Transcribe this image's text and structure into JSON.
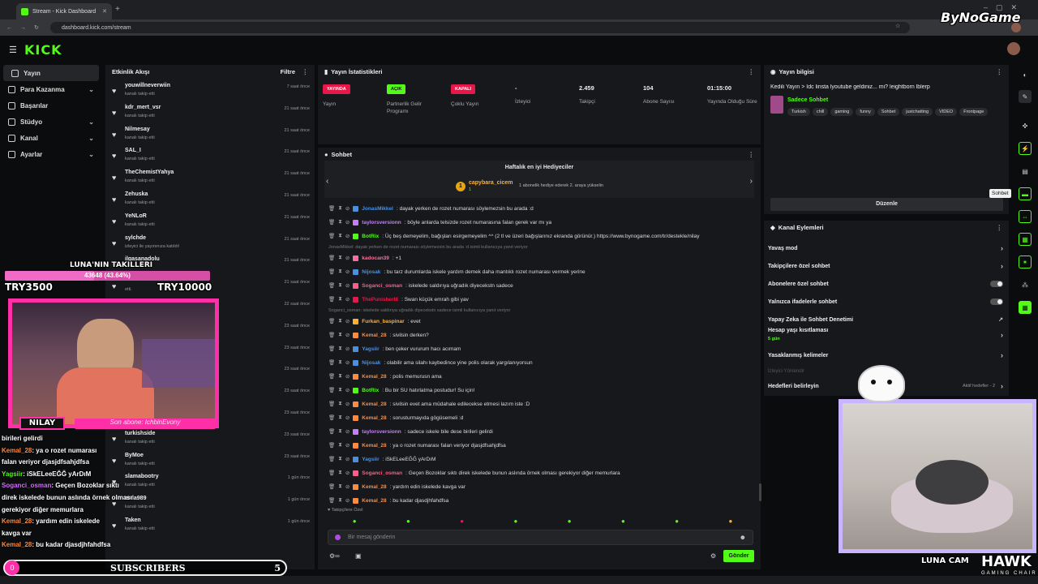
{
  "browser": {
    "tab_title": "Stream - Kick Dashboard",
    "url": "dashboard.kick.com/stream",
    "watermark": "ByNoGame"
  },
  "kick": {
    "logo": "KICK"
  },
  "sidebar": {
    "items": [
      {
        "label": "Yayın",
        "icon": "broadcast-icon"
      },
      {
        "label": "Para Kazanma",
        "icon": "money-icon"
      },
      {
        "label": "Başarılar",
        "icon": "trophy-icon"
      },
      {
        "label": "Stüdyo",
        "icon": "studio-icon"
      },
      {
        "label": "Kanal",
        "icon": "channel-icon"
      },
      {
        "label": "Ayarlar",
        "icon": "gear-icon"
      }
    ]
  },
  "activity": {
    "title": "Etkinlik Akışı",
    "filter": "Filtre",
    "items": [
      {
        "name": "youwillneverwiin",
        "sub": "kanalı takip etti",
        "time": "7 saat önce"
      },
      {
        "name": "kdr_mert_vsr",
        "sub": "kanalı takip etti",
        "time": "21 saat önce"
      },
      {
        "name": "Nilmesay",
        "sub": "kanalı takip etti",
        "time": "21 saat önce"
      },
      {
        "name": "SAL_I",
        "sub": "kanalı takip etti",
        "time": "21 saat önce"
      },
      {
        "name": "TheChemistYahya",
        "sub": "kanalı takip etti",
        "time": "21 saat önce"
      },
      {
        "name": "Zehuska",
        "sub": "kanalı takip etti",
        "time": "21 saat önce"
      },
      {
        "name": "YeNLoR",
        "sub": "kanalı takip etti",
        "time": "21 saat önce"
      },
      {
        "name": "sylchde",
        "sub": "izleyici ile yayınınıza katıldı!",
        "time": "21 saat önce"
      },
      {
        "name": "ilgasanadolu",
        "sub": "",
        "time": "21 saat önce"
      },
      {
        "name": "",
        "sub": "etti.",
        "time": "21 saat önce"
      },
      {
        "name": "",
        "sub": "",
        "time": "22 saat önce"
      },
      {
        "name": "",
        "sub": "",
        "time": "23 saat önce"
      },
      {
        "name": "",
        "sub": "",
        "time": "23 saat önce"
      },
      {
        "name": "",
        "sub": "",
        "time": "23 saat önce"
      },
      {
        "name": "",
        "sub": "",
        "time": "23 saat önce"
      },
      {
        "name": "selmansama",
        "sub": "kanalı takip etti",
        "time": "23 saat önce"
      },
      {
        "name": "turkishside",
        "sub": "kanalı takip etti",
        "time": "23 saat önce"
      },
      {
        "name": "ByMoe",
        "sub": "kanalı takip etti",
        "time": "23 saat önce"
      },
      {
        "name": "slamabootry",
        "sub": "kanalı takip etti",
        "time": "1 gün önce"
      },
      {
        "name": "arda989",
        "sub": "kanalı takip etti",
        "time": "1 gün önce"
      },
      {
        "name": "Taken",
        "sub": "kanalı takip etti",
        "time": "1 gün önce"
      }
    ]
  },
  "stats": {
    "title": "Yayın İstatistikleri",
    "items": [
      {
        "badge": "YAYINDA",
        "label": "Yayın",
        "color": "#e8174a"
      },
      {
        "badge": "AÇIK",
        "label": "Partnerlik Gelir Programı",
        "color": "#53fc18"
      },
      {
        "badge": "KAPALI",
        "label": "Çoklu Yayın",
        "color": "#e8174a"
      },
      {
        "value": "-",
        "label": "İzleyici"
      },
      {
        "value": "2.459",
        "label": "Takipçi"
      },
      {
        "value": "104",
        "label": "Abone Sayısı"
      },
      {
        "value": "01:15:00",
        "label": "Yayında Olduğu Süre"
      }
    ]
  },
  "stream_info": {
    "title": "Yayın bilgisi",
    "stream_title": "Kedili Yayın > Idc linsta lyoutube geldiniz... mi? leightborn lblerp",
    "category": "Sadece Sohbet",
    "tags": [
      "Turkish",
      "chill",
      "gaming",
      "funny",
      "Sohbet",
      "justchatting",
      "VIDEO",
      "Frontpage"
    ],
    "edit_label": "Düzenle",
    "tooltip": "Sohbet"
  },
  "chat": {
    "title": "Sohbet",
    "gifters_title": "Haftalık en iyi Hediyeciler",
    "top_gifter": "capybara_cicem",
    "top_gifter_count": "1",
    "gifter_note": "1 abonelik hediye ederek 2. araya yükselin",
    "followers_only": "Takipçilere Özel",
    "input_placeholder": "Bir mesaj gönderin",
    "send_label": "Gönder",
    "messages": [
      {
        "user": "JonasMikkel",
        "text": ": dayak yerken de rozet numarası söylemezsin bu arada :d",
        "color": "#4a90e2"
      },
      {
        "user": "taylorsversionn",
        "text": ": böyle anlarda telsizde rozet numarasına falan gerek var mı ya",
        "color": "#c77dff"
      },
      {
        "user": "BotRix",
        "text": ": Üç beş demeyelim, bağışları esirgemeyelim ^^ (2 tl ve üzeri bağışlarınız ekranda görünür.) https://www.bynogame.com/tr/destekle/nilay",
        "color": "#53fc18"
      },
      {
        "reply": "JonasMikkel: dayak yerken de rozet numarası söylemezsin bu arada :d isimli kullanıcıya yanıt veriyor"
      },
      {
        "user": "kadocan39",
        "text": ": +1",
        "color": "#ff6b9a"
      },
      {
        "user": "Nijosak",
        "text": ": bu tarz durumlarda iskele yardım demek daha mantıklı rozet numarası vermek yerine",
        "color": "#4a90e2"
      },
      {
        "user": "Soganci_osman",
        "text": ": iskelede saldırıya uğradık diyecekstn sadece",
        "color": "#ff5c8a"
      },
      {
        "user": "ThePunisherIII",
        "text": ": Swan küçük emrah gibi yav",
        "color": "#e8174a"
      },
      {
        "reply": "Soganci_osman: iskelede saldırıya uğradık diyecekstn sadece isimli kullanıcıya yanıt veriyor"
      },
      {
        "user": "Furkan_baspinar",
        "text": ": evet",
        "color": "#ffb02e"
      },
      {
        "user": "Kemal_28",
        "text": ": sivilsin derken?",
        "color": "#ff8a3d"
      },
      {
        "user": "Yagsiir",
        "text": ": ben çeker vururum hacı acımam",
        "color": "#4a90e2"
      },
      {
        "user": "Nijosak",
        "text": ": olabilir ama silahı kaybedince yine polis olarak yargılanıyorsun",
        "color": "#4a90e2"
      },
      {
        "user": "Kemal_28",
        "text": ": polis memurusn ama",
        "color": "#ff8a3d"
      },
      {
        "user": "BotRix",
        "text": ": Bu bir SU hatırlatma postudur! Su için!",
        "color": "#53fc18"
      },
      {
        "user": "Kemal_28",
        "text": ": sivilsin evet ama müdahale edilecekse etmesi lazım iste :D",
        "color": "#ff8a3d"
      },
      {
        "user": "Kemal_28",
        "text": ": sorusturmayıda gögüsemeli :d",
        "color": "#ff8a3d"
      },
      {
        "user": "taylorsversionn",
        "text": ": sadece iskele bile dese birileri gelirdi",
        "color": "#c77dff"
      },
      {
        "user": "Kemal_28",
        "text": ": ya o rozet numarası falan veriyor djasjdfsahjdfsa",
        "color": "#ff8a3d"
      },
      {
        "user": "Yagsiir",
        "text": ": iSkELeeEĞĞ yArDıM",
        "color": "#4a90e2"
      },
      {
        "user": "Soganci_osman",
        "text": ": Geçen Bozoklar sıktı direk iskelede bunun aslında örnek olması gerekiyor diğer memurlara",
        "color": "#ff5c8a"
      },
      {
        "user": "Kemal_28",
        "text": ": yardım edin iskelede kavga var",
        "color": "#ff8a3d"
      },
      {
        "user": "Kemal_28",
        "text": ": bu kadar djasdjhfahdfsa",
        "color": "#ff8a3d"
      }
    ]
  },
  "channel_actions": {
    "title": "Kanal Eylemleri",
    "items": [
      {
        "label": "Yavaş mod",
        "kind": "chevron"
      },
      {
        "label": "Takipçilere özel sohbet",
        "kind": "chevron"
      },
      {
        "label": "Abonelere özel sohbet",
        "kind": "toggle"
      },
      {
        "label": "Yalnızca ifadelerle sohbet",
        "kind": "toggle"
      },
      {
        "label": "Yapay Zeka ile Sohbet Denetimi",
        "kind": "ext"
      },
      {
        "label": "Hesap yaşı kısıtlaması",
        "kind": "chevron",
        "sub": "5 gün"
      },
      {
        "label": "Yasaklanmış kelimeler",
        "kind": "chevron"
      },
      {
        "label": "İzleyici Yönlendir",
        "kind": "none"
      },
      {
        "label": "Hedefleri belirleyin",
        "kind": "chevron",
        "note": "Aktif hedefler - 2"
      }
    ]
  },
  "overlay": {
    "goal_title": "LUNA'NIN TAKILLERI",
    "goal_progress": "43648 (43.64%)",
    "goal_left": "TRY3500",
    "goal_right": "TRY10000",
    "cam_name": "NILAY",
    "last_sub": "Son abone: IchbinEvony",
    "chat_lines": [
      {
        "user": "",
        "text": "birileri gelirdi"
      },
      {
        "user": "Kemal_28",
        "text": ": ya o rozet numarası"
      },
      {
        "user": "",
        "text": "falan veriyor djasjdfsahjdfsa"
      },
      {
        "user": "Yagsiir",
        "text": ": iSkELeeEĞĞ yArDıM"
      },
      {
        "user": "Soganci_osman",
        "text": ": Geçen Bozoklar sıktı"
      },
      {
        "user": "",
        "text": "direk iskelede bunun aslında örnek olması"
      },
      {
        "user": "",
        "text": "gerekiyor diğer memurlara"
      },
      {
        "user": "Kemal_28",
        "text": ": yardım edin iskelede"
      },
      {
        "user": "",
        "text": "kavga var"
      },
      {
        "user": "Kemal_28",
        "text": ": bu kadar djasdjhfahdfsa"
      }
    ],
    "subs_count_left": "0",
    "subs_label": "SUBSCRIBERS",
    "subs_count_right": "5",
    "cat_cam_label": "LUNA CAM",
    "brand": "HAWK",
    "brand_sub": "GAMING CHAIR"
  }
}
